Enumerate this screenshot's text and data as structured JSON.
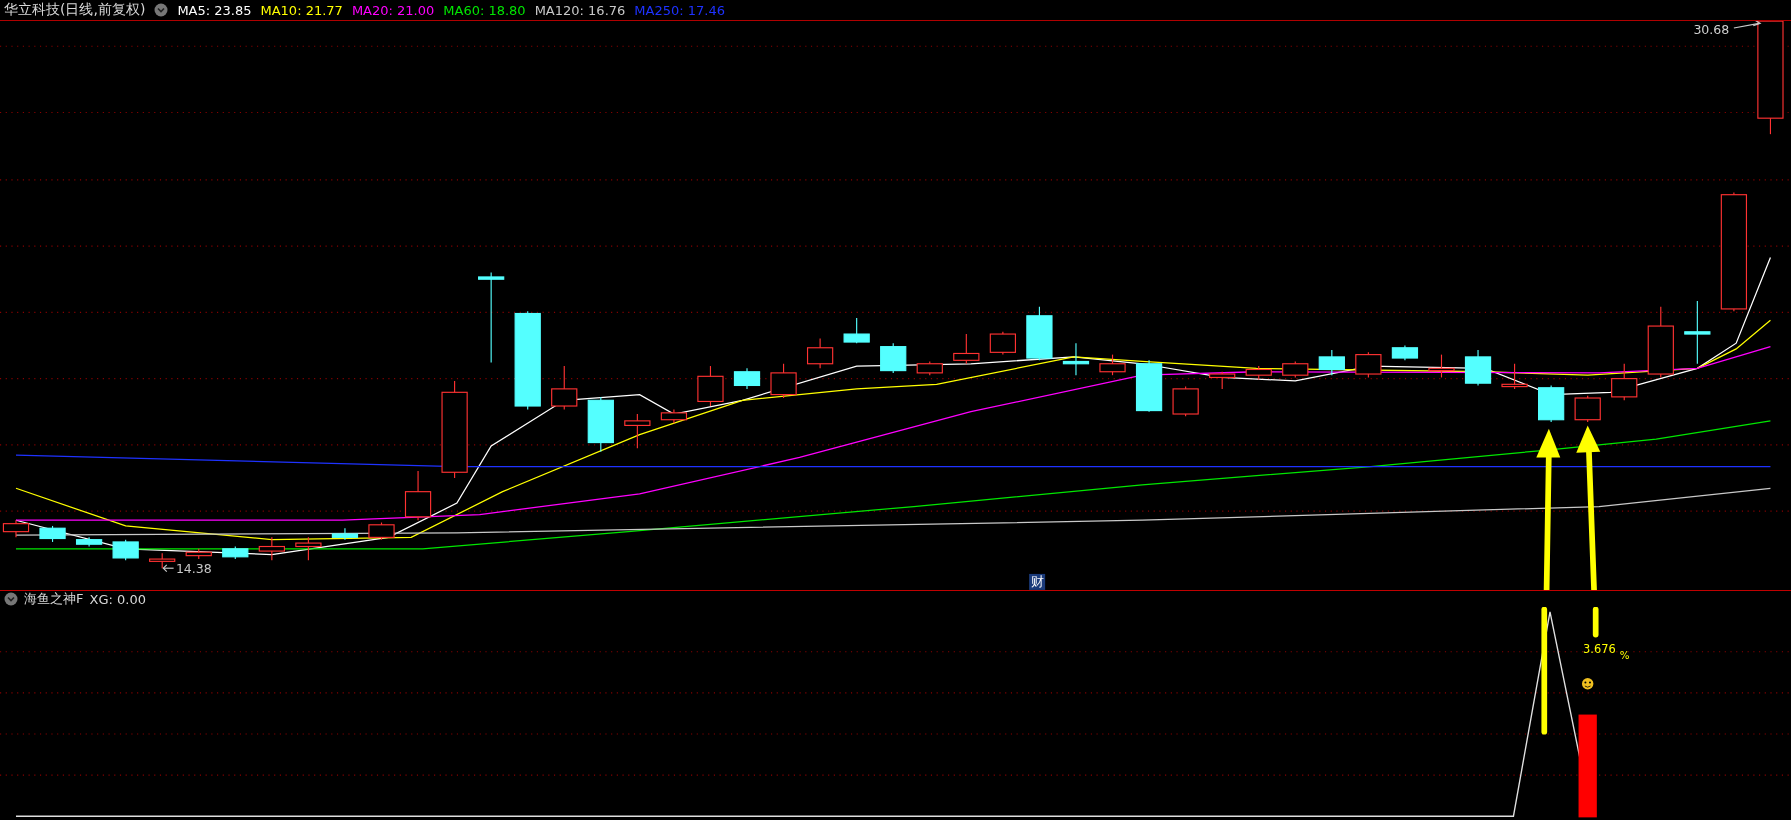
{
  "header": {
    "title": "华立科技(日线,前复权)"
  },
  "moving_averages": [
    {
      "label": "MA5: 23.85",
      "color": "#ffffff"
    },
    {
      "label": "MA10: 21.77",
      "color": "#ffff00"
    },
    {
      "label": "MA20: 21.00",
      "color": "#ff00ff"
    },
    {
      "label": "MA60: 18.80",
      "color": "#00e600"
    },
    {
      "label": "MA120: 16.76",
      "color": "#c8c8c8"
    },
    {
      "label": "MA250: 17.46",
      "color": "#1e32ff"
    }
  ],
  "price_marks": {
    "high": "30.68",
    "low": "14.38"
  },
  "event_tag": "财",
  "indicator": {
    "title": "海鱼之神F",
    "reading": "XG: 0.00",
    "signal_value": "3.676",
    "signal_unit": "%"
  }
}
